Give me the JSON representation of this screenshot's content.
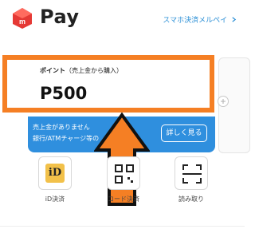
{
  "header": {
    "app_name": "Pay",
    "logo_icon": "merpay-logo-icon",
    "link_label": "スマホ決済メルペイ",
    "link_icon": "chevron-right-icon"
  },
  "points_card": {
    "label": "ポイント",
    "sub_label": "（売上金から購入）",
    "value": "P500"
  },
  "sales_banner": {
    "line1": "売上金がありません",
    "line2": "銀行/ATMチャージ等の",
    "button_label": "詳しく見る"
  },
  "actions": [
    {
      "label": "iD決済",
      "icon": "id-payment-icon",
      "icon_text": "iD"
    },
    {
      "label": "コード決済",
      "icon": "qr-code-icon"
    },
    {
      "label": "読み取り",
      "icon": "scan-frame-icon"
    }
  ],
  "peek": {
    "icon": "plus-circle-icon"
  },
  "colors": {
    "accent_blue": "#2f8fde",
    "highlight_orange": "#f57f24",
    "logo_red": "#e53935",
    "id_yellow": "#f2c14a"
  }
}
